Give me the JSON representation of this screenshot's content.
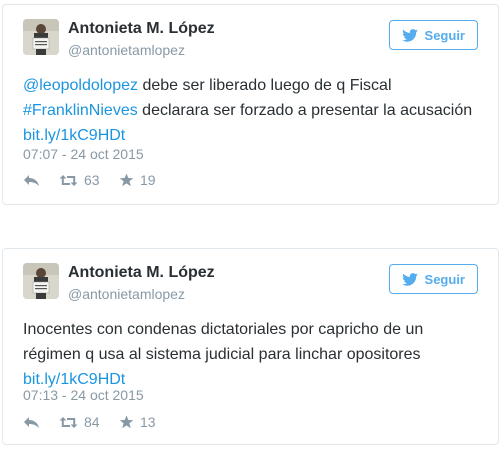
{
  "tweets": [
    {
      "author_name": "Antonieta M. López",
      "author_handle": "@antonietamlopez",
      "follow_label": "Seguir",
      "text_lines": [
        [
          {
            "text": "@leopoldolopez",
            "link": true
          },
          {
            "text": " debe ser liberado luego de q Fiscal",
            "link": false
          }
        ],
        [
          {
            "text": "#FranklinNieves",
            "link": true
          },
          {
            "text": " declarara ser forzado a presentar la acusación",
            "link": false
          }
        ],
        [
          {
            "text": "bit.ly/1kC9HDt",
            "link": true
          }
        ]
      ],
      "timestamp": "07:07 - 24 oct 2015",
      "retweets": "63",
      "favorites": "19"
    },
    {
      "author_name": "Antonieta M. López",
      "author_handle": "@antonietamlopez",
      "follow_label": "Seguir",
      "text_lines": [
        [
          {
            "text": "Inocentes con condenas dictatoriales por capricho de un",
            "link": false
          }
        ],
        [
          {
            "text": "régimen q usa al sistema judicial para linchar opositores",
            "link": false
          }
        ],
        [
          {
            "text": "bit.ly/1kC9HDt",
            "link": true
          }
        ]
      ],
      "timestamp": "07:13 - 24 oct 2015",
      "retweets": "84",
      "favorites": "13"
    }
  ],
  "icons": {
    "follow": "twitter-bird-icon",
    "reply": "reply-icon",
    "retweet": "retweet-icon",
    "favorite": "star-icon"
  },
  "colors": {
    "link": "#1b95e0",
    "brand": "#55acee",
    "muted": "#8899a6",
    "text": "#292f33",
    "border": "#e1e8ed"
  }
}
